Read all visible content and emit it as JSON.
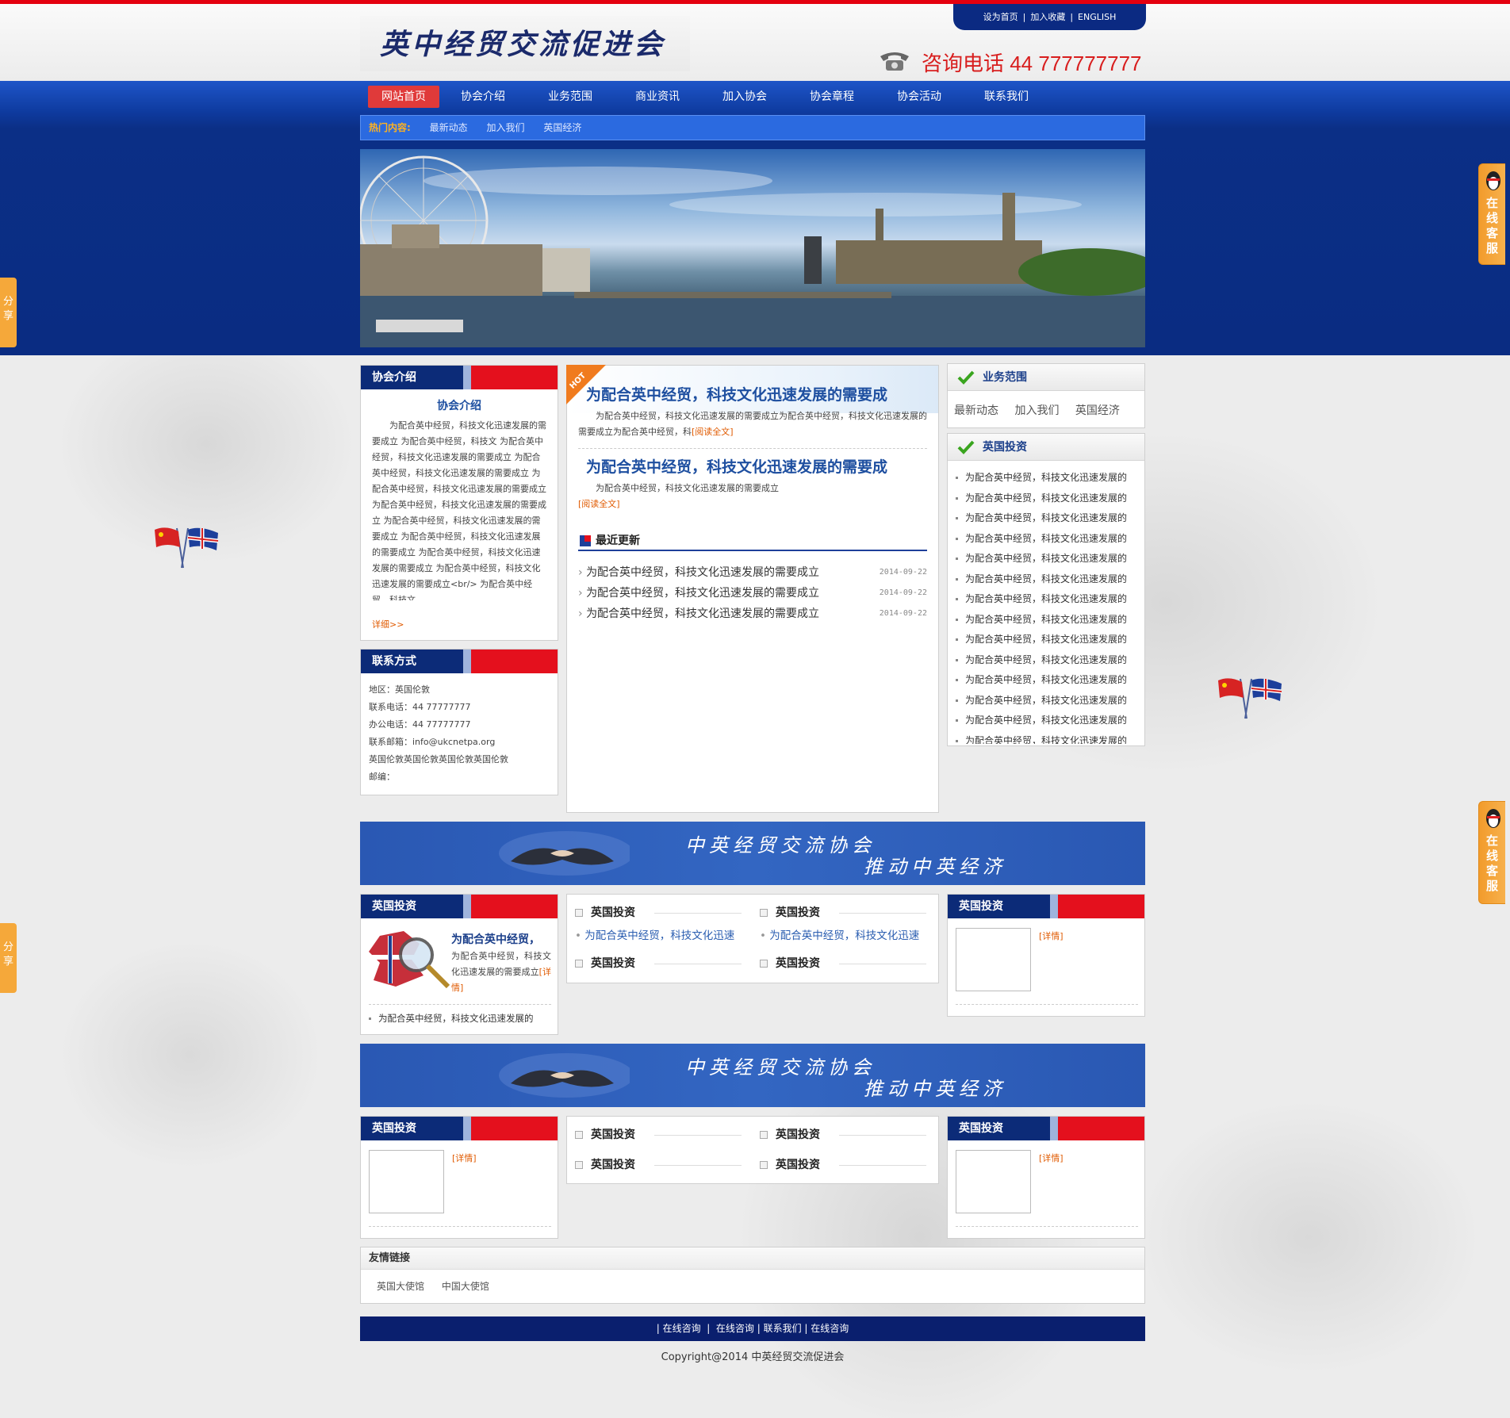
{
  "site": {
    "logo_text": "英中经贸交流促进会",
    "top_links": [
      "设为首页",
      "加入收藏",
      "ENGLISH"
    ],
    "phone": "咨询电话 44 777777777"
  },
  "nav": {
    "items": [
      "网站首页",
      "协会介绍",
      "业务范围",
      "商业资讯",
      "加入协会",
      "协会章程",
      "协会活动",
      "联系我们"
    ]
  },
  "hot": {
    "label": "热门内容:",
    "items": [
      "最新动态",
      "加入我们",
      "英国经济"
    ]
  },
  "about": {
    "header": "协会介绍",
    "title": "协会介绍",
    "body": "为配合英中经贸，科技文化迅速发展的需要成立 为配合英中经贸，科技文 为配合英中经贸，科技文化迅速发展的需要成立 为配合英中经贸，科技文化迅速发展的需要成立 为配合英中经贸，科技文化迅速发展的需要成立 为配合英中经贸，科技文化迅速发展的需要成立 为配合英中经贸，科技文化迅速发展的需要成立 为配合英中经贸，科技文化迅速发展的需要成立 为配合英中经贸，科技文化迅速发展的需要成立 为配合英中经贸，科技文化迅速发展的需要成立<br/> 为配合英中经贸，科技文...",
    "more": "详细>>"
  },
  "contact": {
    "header": "联系方式",
    "lines": [
      "地区：英国伦敦",
      "联系电话：44 77777777",
      "办公电话：44 77777777",
      "联系邮箱：info@ukcnetpa.org",
      "英国伦敦英国伦敦英国伦敦英国伦敦",
      "邮编："
    ]
  },
  "featured": {
    "hot_badge": "HOT",
    "items": [
      {
        "title": "为配合英中经贸，科技文化迅速发展的需要成",
        "summary": "为配合英中经贸，科技文化迅速发展的需要成立为配合英中经贸，科技文化迅速发展的需要成立为配合英中经贸，科",
        "more": "[阅读全文]"
      },
      {
        "title": "为配合英中经贸，科技文化迅速发展的需要成",
        "summary": "为配合英中经贸，科技文化迅速发展的需要成立",
        "more": "[阅读全文]"
      }
    ]
  },
  "updates": {
    "header": "最近更新",
    "items": [
      {
        "title": "为配合英中经贸，科技文化迅速发展的需要成立",
        "date": "2014-09-22"
      },
      {
        "title": "为配合英中经贸，科技文化迅速发展的需要成立",
        "date": "2014-09-22"
      },
      {
        "title": "为配合英中经贸，科技文化迅速发展的需要成立",
        "date": "2014-09-22"
      }
    ]
  },
  "business": {
    "header": "业务范围",
    "items": [
      "最新动态",
      "加入我们",
      "英国经济"
    ]
  },
  "uk_invest": {
    "header": "英国投资",
    "items": [
      "为配合英中经贸，科技文化迅速发展的",
      "为配合英中经贸，科技文化迅速发展的",
      "为配合英中经贸，科技文化迅速发展的",
      "为配合英中经贸，科技文化迅速发展的",
      "为配合英中经贸，科技文化迅速发展的",
      "为配合英中经贸，科技文化迅速发展的",
      "为配合英中经贸，科技文化迅速发展的",
      "为配合英中经贸，科技文化迅速发展的",
      "为配合英中经贸，科技文化迅速发展的",
      "为配合英中经贸，科技文化迅速发展的",
      "为配合英中经贸，科技文化迅速发展的",
      "为配合英中经贸，科技文化迅速发展的",
      "为配合英中经贸，科技文化迅速发展的",
      "为配合英中经贸，科技文化迅速发展的"
    ]
  },
  "slogan": {
    "line1": "中英经贸交流协会",
    "line2": "推动中英经济"
  },
  "row1": {
    "left": {
      "header": "英国投资",
      "title": "为配合英中经贸，",
      "body": "为配合英中经贸，科技文化迅速发展的需要成立",
      "more": "[详情]",
      "list_item": "为配合英中经贸，科技文化迅速发展的"
    },
    "mid": {
      "col_a_title": "英国投资",
      "col_b_title": "英国投资",
      "col_a_link": "为配合英中经贸，科技文化迅速",
      "col_b_link": "为配合英中经贸，科技文化迅速",
      "col_a_title2": "英国投资",
      "col_b_title2": "英国投资"
    },
    "right": {
      "header": "英国投资",
      "more": "[详情]"
    }
  },
  "row2": {
    "left": {
      "header": "英国投资",
      "more": "[详情]"
    },
    "mid": {
      "a1": "英国投资",
      "b1": "英国投资",
      "a2": "英国投资",
      "b2": "英国投资"
    },
    "right": {
      "header": "英国投资",
      "more": "[详情]"
    }
  },
  "links": {
    "header": "友情链接",
    "items": [
      "英国大使馆",
      "中国大使馆"
    ]
  },
  "footer": {
    "links": [
      "在线咨询",
      "在线咨询",
      "联系我们",
      "在线咨询"
    ],
    "copyright": "Copyright@2014 中英经贸交流促进会"
  },
  "side": {
    "service": "在线客服",
    "share": "分享"
  }
}
